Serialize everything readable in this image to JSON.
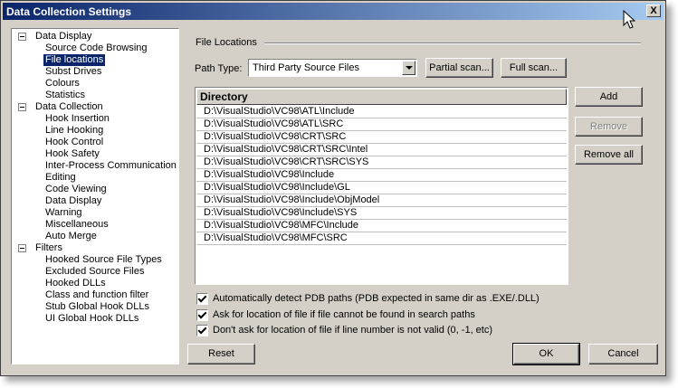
{
  "window": {
    "title": "Data Collection Settings",
    "close_label": "X"
  },
  "tree": {
    "groups": [
      {
        "label": "Data Display",
        "items": [
          "Source Code Browsing",
          "File locations",
          "Subst Drives",
          "Colours",
          "Statistics"
        ]
      },
      {
        "label": "Data Collection",
        "items": [
          "Hook Insertion",
          "Line Hooking",
          "Hook Control",
          "Hook Safety",
          "Inter-Process Communication",
          "Editing",
          "Code Viewing",
          "Data Display",
          "Warning",
          "Miscellaneous",
          "Auto Merge"
        ]
      },
      {
        "label": "Filters",
        "items": [
          "Hooked Source File Types",
          "Excluded Source Files",
          "Hooked DLLs",
          "Class and function filter",
          "Stub Global Hook DLLs",
          "UI Global Hook DLLs"
        ]
      }
    ],
    "selected": "File locations"
  },
  "panel": {
    "group_title": "File Locations",
    "path_type_label": "Path Type:",
    "path_type_value": "Third Party Source Files",
    "partial_scan": "Partial scan...",
    "full_scan": "Full scan...",
    "list_header": "Directory",
    "directories": [
      "D:\\VisualStudio\\VC98\\ATL\\Include",
      "D:\\VisualStudio\\VC98\\ATL\\SRC",
      "D:\\VisualStudio\\VC98\\CRT\\SRC",
      "D:\\VisualStudio\\VC98\\CRT\\SRC\\Intel",
      "D:\\VisualStudio\\VC98\\CRT\\SRC\\SYS",
      "D:\\VisualStudio\\VC98\\Include",
      "D:\\VisualStudio\\VC98\\Include\\GL",
      "D:\\VisualStudio\\VC98\\Include\\ObjModel",
      "D:\\VisualStudio\\VC98\\Include\\SYS",
      "D:\\VisualStudio\\VC98\\MFC\\Include",
      "D:\\VisualStudio\\VC98\\MFC\\SRC"
    ],
    "add": "Add",
    "remove": "Remove",
    "remove_all": "Remove all",
    "checks": [
      "Automatically detect PDB paths (PDB expected in same dir as .EXE/.DLL)",
      "Ask for location of file if file cannot be found in search paths",
      "Don't ask for location of file if line number is not valid (0, -1, etc)"
    ]
  },
  "footer": {
    "reset": "Reset",
    "ok": "OK",
    "cancel": "Cancel"
  }
}
